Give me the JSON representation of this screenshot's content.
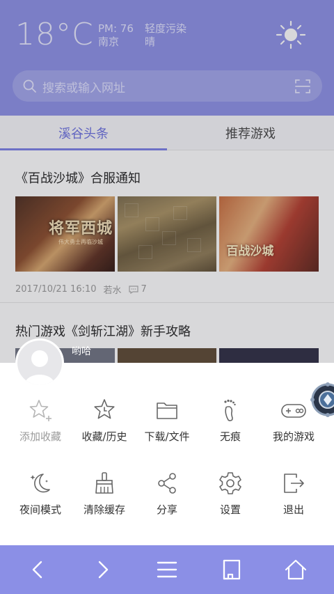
{
  "weather": {
    "temperature": "18°C",
    "pm": "PM: 76",
    "pollution": "轻度污染",
    "city": "南京",
    "condition": "晴",
    "icon": "sun-icon"
  },
  "search": {
    "placeholder": "搜索或输入网址",
    "icon": "search-icon",
    "scan_icon": "scan-icon"
  },
  "tabs": [
    {
      "label": "溪谷头条",
      "active": true
    },
    {
      "label": "推荐游戏",
      "active": false
    }
  ],
  "articles": [
    {
      "title": "《百战沙城》合服通知",
      "thumb1_text": "将军西城",
      "thumb1_sub": "伟大勇士再临沙城",
      "thumb3_text": "百战沙城",
      "date": "2017/10/21 16:10",
      "author": "若水",
      "comments": "7"
    },
    {
      "title": "热门游戏《剑斩江湖》新手攻略"
    }
  ],
  "user": {
    "name": "哟哈"
  },
  "menu": {
    "row1": [
      {
        "label": "添加收藏",
        "icon": "star-plus-icon",
        "enabled": false
      },
      {
        "label": "收藏/历史",
        "icon": "star-clock-icon",
        "enabled": true
      },
      {
        "label": "下载/文件",
        "icon": "folder-icon",
        "enabled": true
      },
      {
        "label": "无痕",
        "icon": "footprint-icon",
        "enabled": true
      },
      {
        "label": "我的游戏",
        "icon": "gamepad-icon",
        "enabled": true
      }
    ],
    "row2": [
      {
        "label": "夜间模式",
        "icon": "moon-icon",
        "enabled": true
      },
      {
        "label": "清除缓存",
        "icon": "broom-icon",
        "enabled": true
      },
      {
        "label": "分享",
        "icon": "share-icon",
        "enabled": true
      },
      {
        "label": "设置",
        "icon": "gear-icon",
        "enabled": true
      },
      {
        "label": "退出",
        "icon": "exit-icon",
        "enabled": true
      }
    ]
  },
  "bottom_nav": [
    "back-icon",
    "forward-icon",
    "menu-icon",
    "tabs-icon",
    "home-icon"
  ],
  "colors": {
    "header": "#8b8fe6",
    "accent": "#6a6fe0",
    "icon_stroke": "#666666"
  }
}
